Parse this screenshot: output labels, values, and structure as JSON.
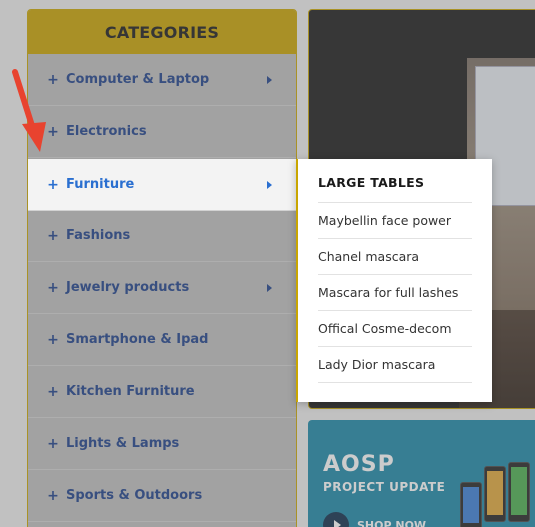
{
  "categories": {
    "header": "CATEGORIES",
    "items": [
      {
        "label": "Computer & Laptop",
        "has_submenu": true
      },
      {
        "label": "Electronics",
        "has_submenu": false
      },
      {
        "label": "Furniture",
        "has_submenu": true
      },
      {
        "label": "Fashions",
        "has_submenu": false
      },
      {
        "label": "Jewelry products",
        "has_submenu": true
      },
      {
        "label": "Smartphone & Ipad",
        "has_submenu": false
      },
      {
        "label": "Kitchen Furniture",
        "has_submenu": false
      },
      {
        "label": "Lights & Lamps",
        "has_submenu": false
      },
      {
        "label": "Sports & Outdoors",
        "has_submenu": false
      }
    ],
    "plus_glyph": "+",
    "active_index": 2
  },
  "submenu": {
    "title": "LARGE TABLES",
    "items": [
      "Maybellin face power",
      "Chanel mascara",
      "Mascara for full lashes",
      "Offical Cosme-decom",
      "Lady Dior mascara"
    ]
  },
  "banner": {
    "title": "AOSP",
    "subtitle": "PROJECT UPDATE",
    "cta": "SHOP NOW"
  },
  "colors": {
    "accent": "#c9a400",
    "link": "#1c3f8a",
    "active_link": "#2a6fd0",
    "pointer": "#e8432f"
  }
}
